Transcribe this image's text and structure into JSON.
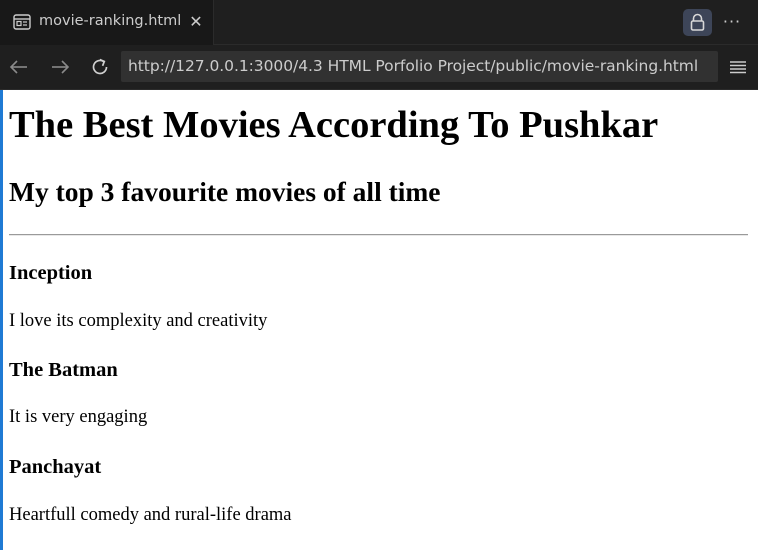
{
  "browser": {
    "tab": {
      "title": "movie-ranking.html",
      "close_glyph": "✕",
      "icon": "browser-preview-icon"
    },
    "actions": {
      "lock_icon": "lock-icon",
      "more_glyph": "···"
    },
    "nav": {
      "back_icon": "arrow-left-icon",
      "forward_icon": "arrow-right-icon",
      "reload_icon": "reload-icon",
      "url": "http://127.0.0.1:3000/4.3 HTML Porfolio Project/public/movie-ranking.html",
      "menu_icon": "hamburger-menu-icon"
    },
    "colors": {
      "chrome_bg": "#1f1f1f",
      "active_tab_bg": "#181818",
      "url_bg": "#313131",
      "accent": "#1f7ad4",
      "lock_bg": "#3d4558"
    }
  },
  "page": {
    "heading": "The Best Movies According To Pushkar",
    "subheading": "My top 3 favourite movies of all time",
    "movies": [
      {
        "title": "Inception",
        "description": "I love its complexity and creativity"
      },
      {
        "title": "The Batman",
        "description": "It is very engaging"
      },
      {
        "title": "Panchayat",
        "description": "Heartfull comedy and rural-life drama"
      }
    ]
  }
}
